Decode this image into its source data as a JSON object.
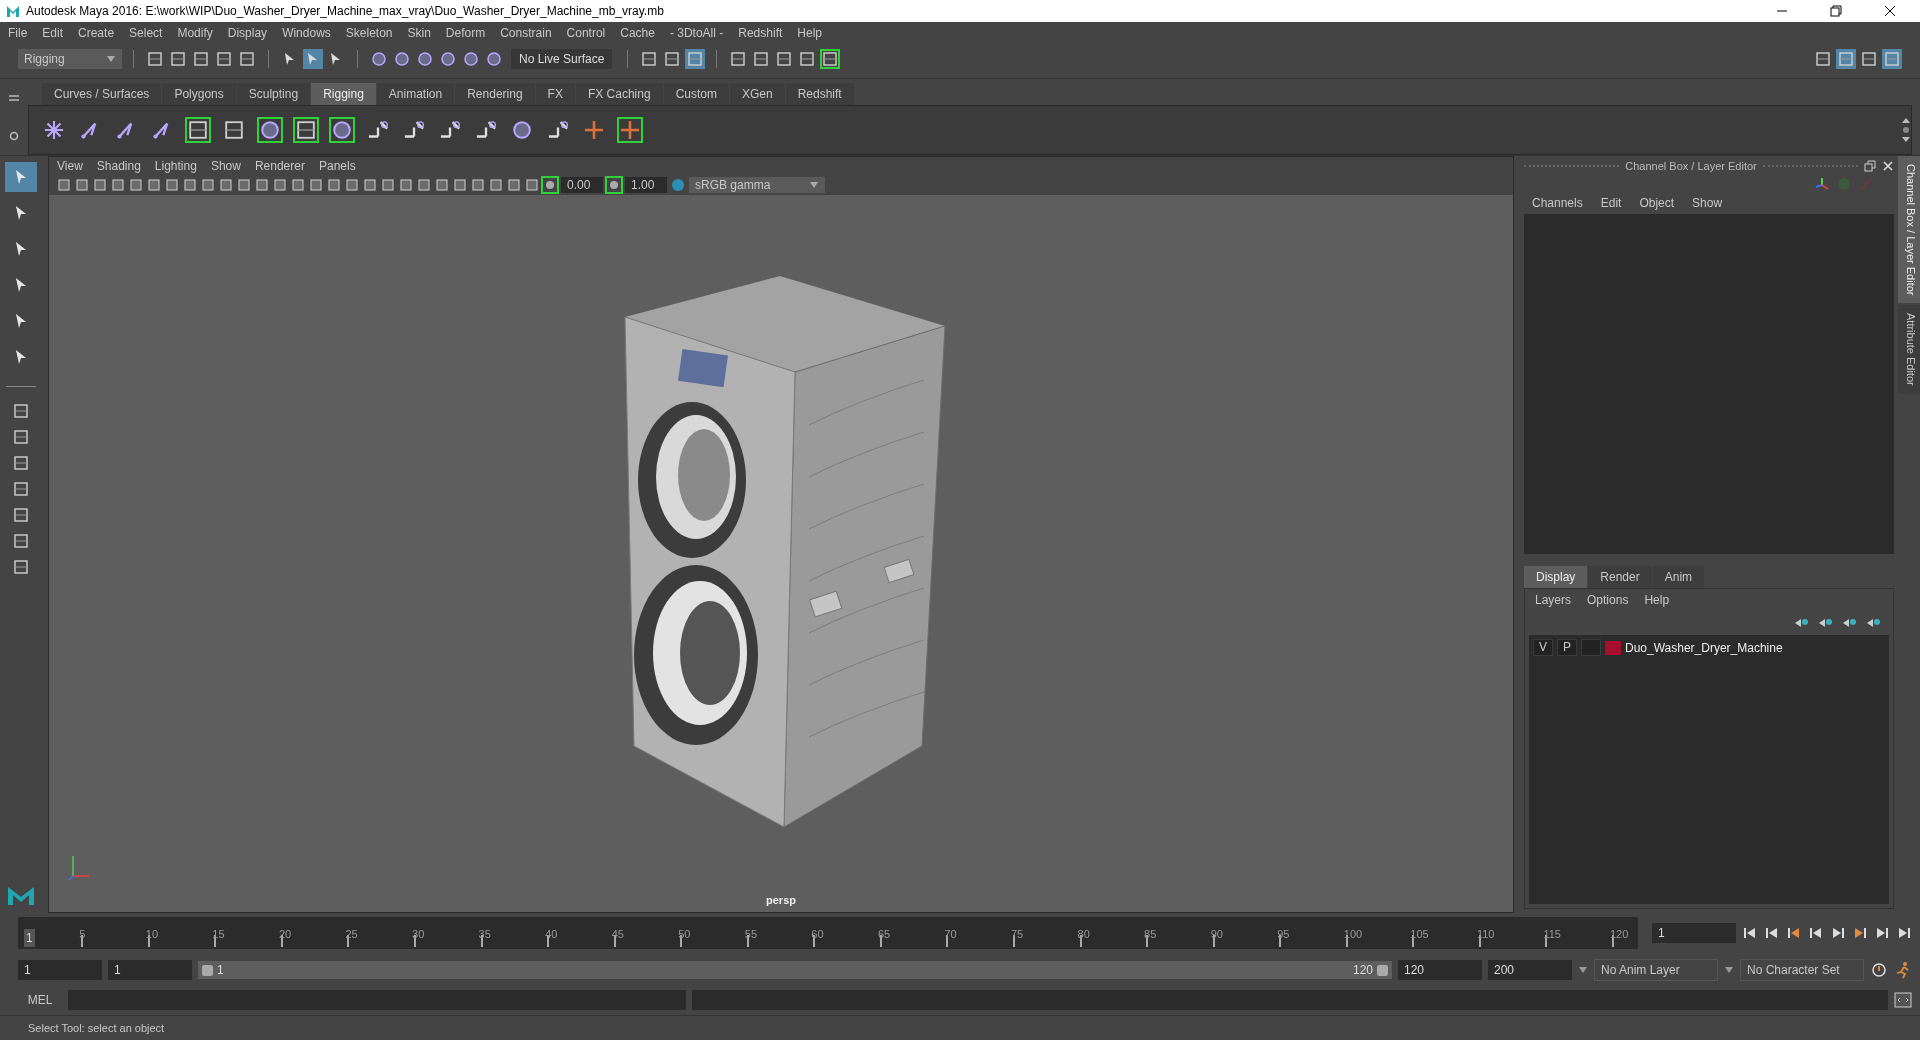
{
  "window": {
    "title": "Autodesk Maya 2016: E:\\work\\WIP\\Duo_Washer_Dryer_Machine_max_vray\\Duo_Washer_Dryer_Machine_mb_vray.mb"
  },
  "menu_bar": [
    "File",
    "Edit",
    "Create",
    "Select",
    "Modify",
    "Display",
    "Windows",
    "Skeleton",
    "Skin",
    "Deform",
    "Constrain",
    "Control",
    "Cache",
    "- 3DtoAll -",
    "Redshift",
    "Help"
  ],
  "status_line": {
    "mode": "Rigging",
    "live_surface": "No Live Surface"
  },
  "shelf_tabs": [
    {
      "label": "Curves / Surfaces",
      "selected": false
    },
    {
      "label": "Polygons",
      "selected": false
    },
    {
      "label": "Sculpting",
      "selected": false
    },
    {
      "label": "Rigging",
      "selected": true
    },
    {
      "label": "Animation",
      "selected": false
    },
    {
      "label": "Rendering",
      "selected": false
    },
    {
      "label": "FX",
      "selected": false
    },
    {
      "label": "FX Caching",
      "selected": false
    },
    {
      "label": "Custom",
      "selected": false
    },
    {
      "label": "XGen",
      "selected": false
    },
    {
      "label": "Redshift",
      "selected": false
    }
  ],
  "toolbox": {
    "tools": [
      {
        "selected": true
      },
      {
        "selected": false
      },
      {
        "selected": false
      },
      {
        "selected": false
      },
      {
        "selected": false
      },
      {
        "selected": false
      }
    ]
  },
  "viewport": {
    "menus": [
      "View",
      "Shading",
      "Lighting",
      "Show",
      "Renderer",
      "Panels"
    ],
    "exposure": "0.00",
    "gamma": "1.00",
    "color_space": "sRGB gamma",
    "camera": "persp"
  },
  "channel_box": {
    "title": "Channel Box / Layer Editor",
    "menus": [
      "Channels",
      "Edit",
      "Object",
      "Show"
    ]
  },
  "side_tabs": [
    {
      "label": "Channel Box / Layer Editor",
      "selected": true
    },
    {
      "label": "Attribute Editor",
      "selected": false
    }
  ],
  "layer_editor": {
    "tabs": [
      {
        "label": "Display",
        "selected": true
      },
      {
        "label": "Render",
        "selected": false
      },
      {
        "label": "Anim",
        "selected": false
      }
    ],
    "menus": [
      "Layers",
      "Options",
      "Help"
    ],
    "layers": [
      {
        "visibility": "V",
        "playback": "P",
        "color": "#a50f2d",
        "name": "Duo_Washer_Dryer_Machine"
      }
    ]
  },
  "timeline": {
    "current_frame": "1",
    "level": 0,
    "ticks": [
      "5",
      "10",
      "15",
      "20",
      "25",
      "30",
      "35",
      "40",
      "45",
      "50",
      "55",
      "60",
      "65",
      "70",
      "75",
      "80",
      "85",
      "90",
      "95",
      "100",
      "105",
      "110",
      "115",
      "120"
    ],
    "frame_field": "1"
  },
  "range": {
    "level": 1,
    "start": "1",
    "playback_start": "1",
    "slider_start": "1",
    "slider_end": "120",
    "playback_end": "120",
    "end": "200",
    "anim_layer": "No Anim Layer",
    "character_set": "No Character Set"
  },
  "command_line": {
    "label": "MEL"
  },
  "help_line": "Select Tool: select an object"
}
